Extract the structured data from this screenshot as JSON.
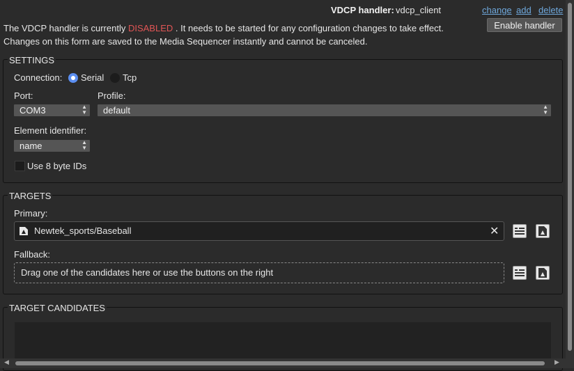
{
  "header": {
    "handler_label": "VDCP handler:",
    "handler_value": "vdcp_client",
    "change_link": "change",
    "add_link": "add",
    "delete_link": "delete",
    "enable_button": "Enable handler"
  },
  "status": {
    "line1_prefix": "The VDCP handler is currently",
    "state": "DISABLED",
    "line1_suffix": ". It needs to be started for any configuration changes to take effect.",
    "line2": "Changes on this form are saved to the Media Sequencer instantly and cannot be canceled."
  },
  "settings": {
    "legend": "SETTINGS",
    "connection_label": "Connection:",
    "serial_label": "Serial",
    "tcp_label": "Tcp",
    "selected_connection": "Serial",
    "port_label": "Port:",
    "port_value": "COM3",
    "profile_label": "Profile:",
    "profile_value": "default",
    "element_identifier_label": "Element identifier:",
    "element_identifier_value": "name",
    "use8_label": "Use 8 byte IDs",
    "use8_checked": false
  },
  "targets": {
    "legend": "TARGETS",
    "primary_label": "Primary:",
    "primary_value": "Newtek_sports/Baseball",
    "fallback_label": "Fallback:",
    "fallback_placeholder": "Drag one of the candidates here or use the buttons on the right"
  },
  "candidates": {
    "legend": "TARGET CANDIDATES"
  },
  "colors": {
    "background": "#2b2b2b",
    "accent": "#5b8ef0",
    "link": "#6fa8dc",
    "disabled": "#e05555"
  }
}
